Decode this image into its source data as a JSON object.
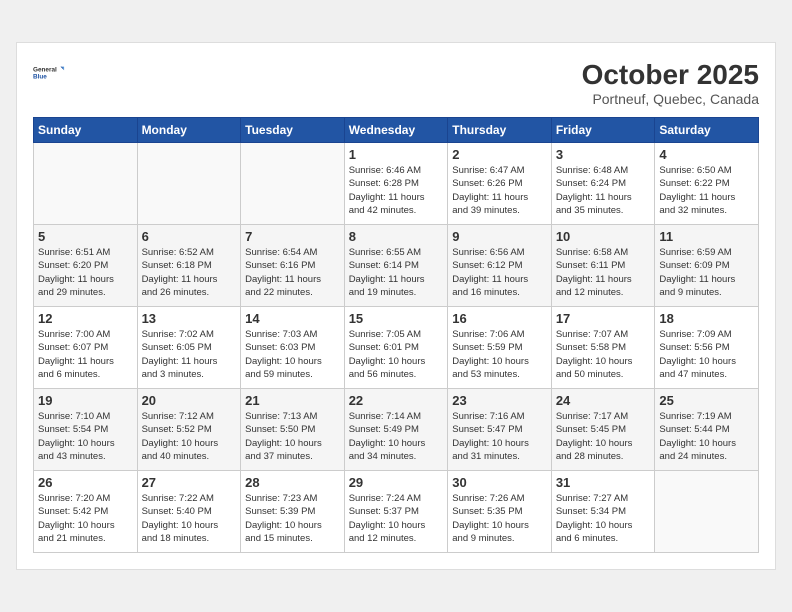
{
  "header": {
    "logo_text_line1": "General",
    "logo_text_line2": "Blue",
    "month": "October 2025",
    "location": "Portneuf, Quebec, Canada"
  },
  "weekdays": [
    "Sunday",
    "Monday",
    "Tuesday",
    "Wednesday",
    "Thursday",
    "Friday",
    "Saturday"
  ],
  "weeks": [
    [
      {
        "day": "",
        "info": ""
      },
      {
        "day": "",
        "info": ""
      },
      {
        "day": "",
        "info": ""
      },
      {
        "day": "1",
        "info": "Sunrise: 6:46 AM\nSunset: 6:28 PM\nDaylight: 11 hours\nand 42 minutes."
      },
      {
        "day": "2",
        "info": "Sunrise: 6:47 AM\nSunset: 6:26 PM\nDaylight: 11 hours\nand 39 minutes."
      },
      {
        "day": "3",
        "info": "Sunrise: 6:48 AM\nSunset: 6:24 PM\nDaylight: 11 hours\nand 35 minutes."
      },
      {
        "day": "4",
        "info": "Sunrise: 6:50 AM\nSunset: 6:22 PM\nDaylight: 11 hours\nand 32 minutes."
      }
    ],
    [
      {
        "day": "5",
        "info": "Sunrise: 6:51 AM\nSunset: 6:20 PM\nDaylight: 11 hours\nand 29 minutes."
      },
      {
        "day": "6",
        "info": "Sunrise: 6:52 AM\nSunset: 6:18 PM\nDaylight: 11 hours\nand 26 minutes."
      },
      {
        "day": "7",
        "info": "Sunrise: 6:54 AM\nSunset: 6:16 PM\nDaylight: 11 hours\nand 22 minutes."
      },
      {
        "day": "8",
        "info": "Sunrise: 6:55 AM\nSunset: 6:14 PM\nDaylight: 11 hours\nand 19 minutes."
      },
      {
        "day": "9",
        "info": "Sunrise: 6:56 AM\nSunset: 6:12 PM\nDaylight: 11 hours\nand 16 minutes."
      },
      {
        "day": "10",
        "info": "Sunrise: 6:58 AM\nSunset: 6:11 PM\nDaylight: 11 hours\nand 12 minutes."
      },
      {
        "day": "11",
        "info": "Sunrise: 6:59 AM\nSunset: 6:09 PM\nDaylight: 11 hours\nand 9 minutes."
      }
    ],
    [
      {
        "day": "12",
        "info": "Sunrise: 7:00 AM\nSunset: 6:07 PM\nDaylight: 11 hours\nand 6 minutes."
      },
      {
        "day": "13",
        "info": "Sunrise: 7:02 AM\nSunset: 6:05 PM\nDaylight: 11 hours\nand 3 minutes."
      },
      {
        "day": "14",
        "info": "Sunrise: 7:03 AM\nSunset: 6:03 PM\nDaylight: 10 hours\nand 59 minutes."
      },
      {
        "day": "15",
        "info": "Sunrise: 7:05 AM\nSunset: 6:01 PM\nDaylight: 10 hours\nand 56 minutes."
      },
      {
        "day": "16",
        "info": "Sunrise: 7:06 AM\nSunset: 5:59 PM\nDaylight: 10 hours\nand 53 minutes."
      },
      {
        "day": "17",
        "info": "Sunrise: 7:07 AM\nSunset: 5:58 PM\nDaylight: 10 hours\nand 50 minutes."
      },
      {
        "day": "18",
        "info": "Sunrise: 7:09 AM\nSunset: 5:56 PM\nDaylight: 10 hours\nand 47 minutes."
      }
    ],
    [
      {
        "day": "19",
        "info": "Sunrise: 7:10 AM\nSunset: 5:54 PM\nDaylight: 10 hours\nand 43 minutes."
      },
      {
        "day": "20",
        "info": "Sunrise: 7:12 AM\nSunset: 5:52 PM\nDaylight: 10 hours\nand 40 minutes."
      },
      {
        "day": "21",
        "info": "Sunrise: 7:13 AM\nSunset: 5:50 PM\nDaylight: 10 hours\nand 37 minutes."
      },
      {
        "day": "22",
        "info": "Sunrise: 7:14 AM\nSunset: 5:49 PM\nDaylight: 10 hours\nand 34 minutes."
      },
      {
        "day": "23",
        "info": "Sunrise: 7:16 AM\nSunset: 5:47 PM\nDaylight: 10 hours\nand 31 minutes."
      },
      {
        "day": "24",
        "info": "Sunrise: 7:17 AM\nSunset: 5:45 PM\nDaylight: 10 hours\nand 28 minutes."
      },
      {
        "day": "25",
        "info": "Sunrise: 7:19 AM\nSunset: 5:44 PM\nDaylight: 10 hours\nand 24 minutes."
      }
    ],
    [
      {
        "day": "26",
        "info": "Sunrise: 7:20 AM\nSunset: 5:42 PM\nDaylight: 10 hours\nand 21 minutes."
      },
      {
        "day": "27",
        "info": "Sunrise: 7:22 AM\nSunset: 5:40 PM\nDaylight: 10 hours\nand 18 minutes."
      },
      {
        "day": "28",
        "info": "Sunrise: 7:23 AM\nSunset: 5:39 PM\nDaylight: 10 hours\nand 15 minutes."
      },
      {
        "day": "29",
        "info": "Sunrise: 7:24 AM\nSunset: 5:37 PM\nDaylight: 10 hours\nand 12 minutes."
      },
      {
        "day": "30",
        "info": "Sunrise: 7:26 AM\nSunset: 5:35 PM\nDaylight: 10 hours\nand 9 minutes."
      },
      {
        "day": "31",
        "info": "Sunrise: 7:27 AM\nSunset: 5:34 PM\nDaylight: 10 hours\nand 6 minutes."
      },
      {
        "day": "",
        "info": ""
      }
    ]
  ]
}
